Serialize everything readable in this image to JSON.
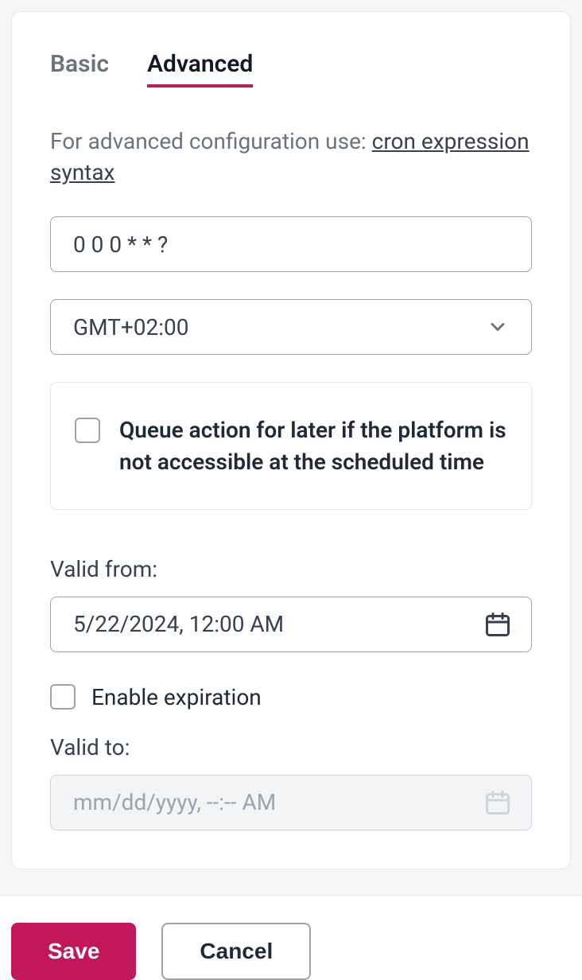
{
  "tabs": {
    "basic": "Basic",
    "advanced": "Advanced"
  },
  "help": {
    "prefix": "For advanced configuration use: ",
    "link": "cron expression syntax"
  },
  "cron": {
    "value": "0 0 0 * * ?"
  },
  "timezone": {
    "selected": "GMT+02:00"
  },
  "queue": {
    "label": "Queue action for later if the platform is not accessible at the scheduled time"
  },
  "validFrom": {
    "label": "Valid from:",
    "value": "5/22/2024, 12:00 AM"
  },
  "expiration": {
    "label": "Enable expiration"
  },
  "validTo": {
    "label": "Valid to:",
    "placeholder": "mm/dd/yyyy, --:-- AM"
  },
  "buttons": {
    "save": "Save",
    "cancel": "Cancel"
  }
}
